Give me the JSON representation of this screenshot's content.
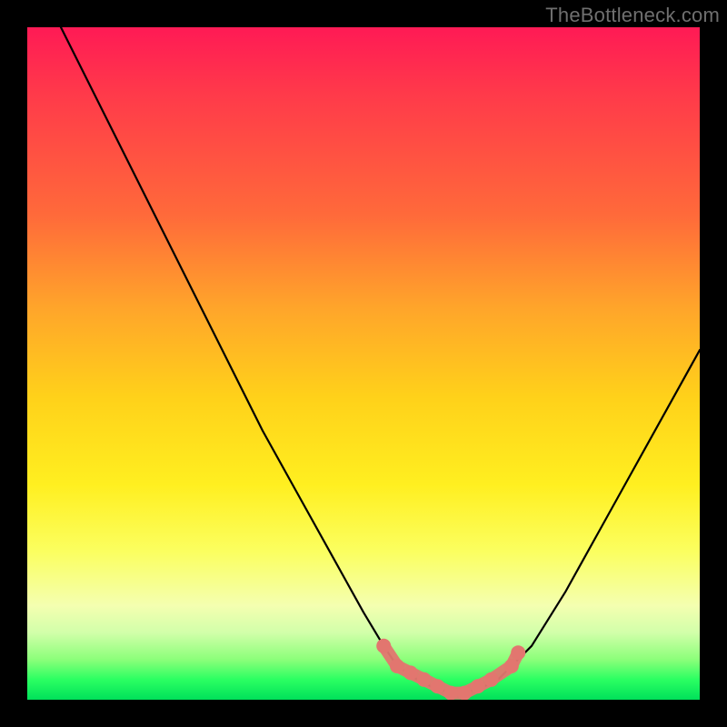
{
  "watermark": {
    "text": "TheBottleneck.com"
  },
  "colors": {
    "frame": "#000000",
    "curve": "#000000",
    "marker": "#e2766f",
    "gradient_top": "#ff1a55",
    "gradient_bottom": "#00e05a"
  },
  "chart_data": {
    "type": "line",
    "title": "",
    "xlabel": "",
    "ylabel": "",
    "xlim": [
      0,
      100
    ],
    "ylim": [
      0,
      100
    ],
    "series": [
      {
        "name": "bottleneck-curve",
        "x": [
          5,
          10,
          15,
          20,
          25,
          30,
          35,
          40,
          45,
          50,
          53,
          55,
          58,
          60,
          63,
          65,
          68,
          70,
          72,
          75,
          80,
          85,
          90,
          95,
          100
        ],
        "values": [
          100,
          90,
          80,
          70,
          60,
          50,
          40,
          31,
          22,
          13,
          8,
          5,
          3,
          2,
          1,
          1,
          2,
          3,
          5,
          8,
          16,
          25,
          34,
          43,
          52
        ]
      }
    ],
    "markers": {
      "name": "highlighted-range",
      "x": [
        53,
        55,
        57,
        59,
        61,
        63,
        65,
        67,
        69,
        72,
        73
      ],
      "values": [
        8,
        5,
        4,
        3,
        2,
        1,
        1,
        2,
        3,
        5,
        7
      ]
    }
  }
}
